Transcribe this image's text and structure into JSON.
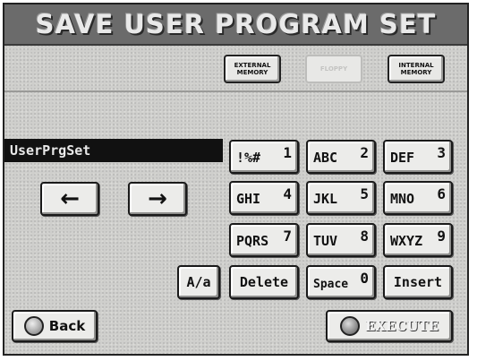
{
  "header": {
    "title": "SAVE USER PROGRAM SET"
  },
  "destinations": [
    {
      "label": "EXTERNAL MEMORY",
      "enabled": true
    },
    {
      "label": "FLOPPY",
      "enabled": false
    },
    {
      "label": "INTERNAL MEMORY",
      "enabled": true
    }
  ],
  "name_field": {
    "value": "UserPrgSet"
  },
  "keypad": [
    {
      "letters": "!%#",
      "number": "1"
    },
    {
      "letters": "ABC",
      "number": "2"
    },
    {
      "letters": "DEF",
      "number": "3"
    },
    {
      "letters": "GHI",
      "number": "4"
    },
    {
      "letters": "JKL",
      "number": "5"
    },
    {
      "letters": "MNO",
      "number": "6"
    },
    {
      "letters": "PQRS",
      "number": "7"
    },
    {
      "letters": "TUV",
      "number": "8"
    },
    {
      "letters": "WXYZ",
      "number": "9"
    }
  ],
  "cursor": {
    "left": "←",
    "right": "→"
  },
  "edit": {
    "case_label": "A/a",
    "delete_label": "Delete",
    "space_letters": "Space",
    "space_number": "0",
    "insert_label": "Insert"
  },
  "footer": {
    "back_label": "Back",
    "execute_label": "EXECUTE"
  },
  "colors": {
    "title_bar": "#6b6b6b",
    "panel": "#cfcfcc",
    "field": "#111111"
  }
}
